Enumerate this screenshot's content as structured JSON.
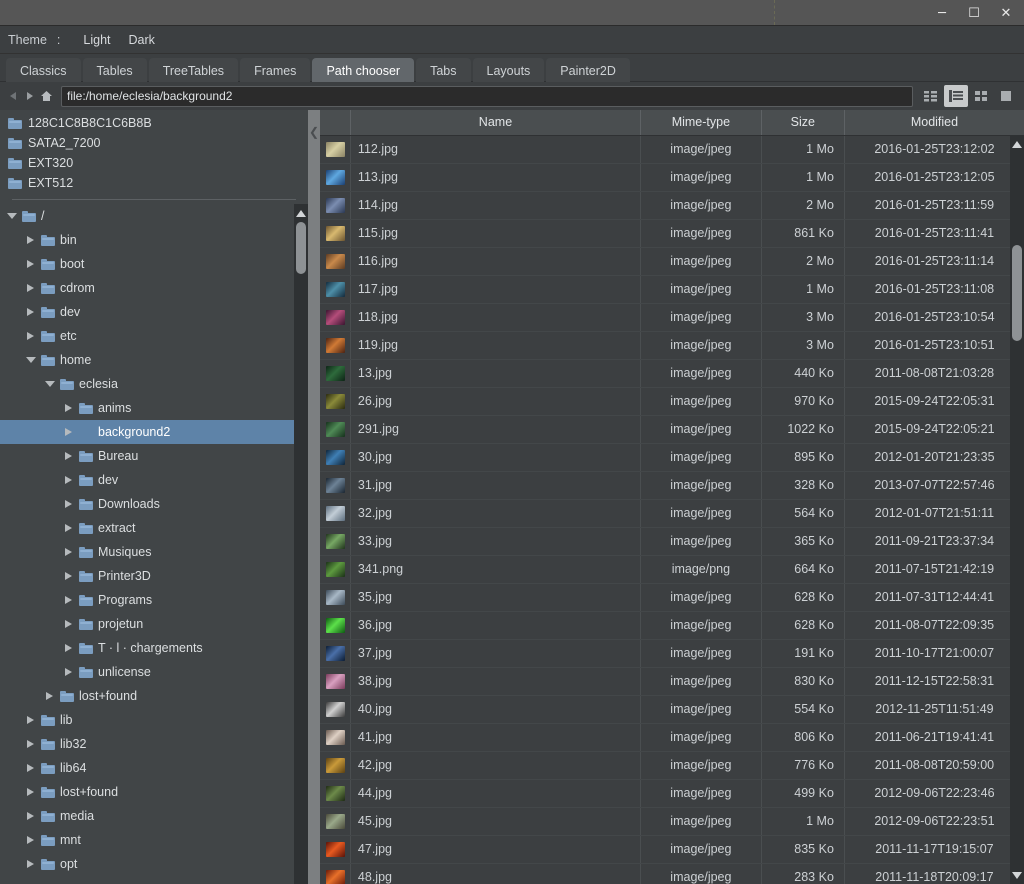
{
  "window": {
    "controls": [
      {
        "name": "minimize",
        "glyph": "—"
      },
      {
        "name": "maximize",
        "glyph": "▢"
      },
      {
        "name": "close",
        "glyph": "✕"
      }
    ]
  },
  "theme_bar": {
    "label": "Theme",
    "separator": ":",
    "options": [
      "Light",
      "Dark"
    ],
    "selected": "Dark"
  },
  "tabs": [
    {
      "label": "Classics",
      "active": false
    },
    {
      "label": "Tables",
      "active": false
    },
    {
      "label": "TreeTables",
      "active": false
    },
    {
      "label": "Frames",
      "active": false
    },
    {
      "label": "Path chooser",
      "active": true
    },
    {
      "label": "Tabs",
      "active": false
    },
    {
      "label": "Layouts",
      "active": false
    },
    {
      "label": "Painter2D",
      "active": false
    }
  ],
  "pathbar": {
    "back_title": "Back",
    "forward_title": "Forward",
    "home_title": "Home",
    "value": "file:/home/eclesia/background2",
    "placeholder": "file:/",
    "view_modes": [
      {
        "name": "compact-list-view",
        "active": false
      },
      {
        "name": "detail-list-view",
        "active": true
      },
      {
        "name": "grid-view",
        "active": false
      },
      {
        "name": "large-icon-view",
        "active": false
      }
    ]
  },
  "sidebar": {
    "places": [
      {
        "label": "128C1C8B8C1C6B8B"
      },
      {
        "label": "SATA2_7200"
      },
      {
        "label": "EXT320"
      },
      {
        "label": "EXT512"
      }
    ],
    "tree": [
      {
        "label": "/",
        "depth": 0,
        "expanded": true,
        "selected": false,
        "hasIcon": true
      },
      {
        "label": "bin",
        "depth": 1,
        "expanded": false,
        "selected": false,
        "hasIcon": true
      },
      {
        "label": "boot",
        "depth": 1,
        "expanded": false,
        "selected": false,
        "hasIcon": true
      },
      {
        "label": "cdrom",
        "depth": 1,
        "expanded": false,
        "selected": false,
        "hasIcon": true
      },
      {
        "label": "dev",
        "depth": 1,
        "expanded": false,
        "selected": false,
        "hasIcon": true
      },
      {
        "label": "etc",
        "depth": 1,
        "expanded": false,
        "selected": false,
        "hasIcon": true
      },
      {
        "label": "home",
        "depth": 1,
        "expanded": true,
        "selected": false,
        "hasIcon": true
      },
      {
        "label": "eclesia",
        "depth": 2,
        "expanded": true,
        "selected": false,
        "hasIcon": true
      },
      {
        "label": "anims",
        "depth": 3,
        "expanded": false,
        "selected": false,
        "hasIcon": true
      },
      {
        "label": "background2",
        "depth": 3,
        "expanded": false,
        "selected": true,
        "hasIcon": false
      },
      {
        "label": "Bureau",
        "depth": 3,
        "expanded": false,
        "selected": false,
        "hasIcon": true
      },
      {
        "label": "dev",
        "depth": 3,
        "expanded": false,
        "selected": false,
        "hasIcon": true
      },
      {
        "label": "Downloads",
        "depth": 3,
        "expanded": false,
        "selected": false,
        "hasIcon": true
      },
      {
        "label": "extract",
        "depth": 3,
        "expanded": false,
        "selected": false,
        "hasIcon": true
      },
      {
        "label": "Musiques",
        "depth": 3,
        "expanded": false,
        "selected": false,
        "hasIcon": true
      },
      {
        "label": "Printer3D",
        "depth": 3,
        "expanded": false,
        "selected": false,
        "hasIcon": true
      },
      {
        "label": "Programs",
        "depth": 3,
        "expanded": false,
        "selected": false,
        "hasIcon": true
      },
      {
        "label": "projetun",
        "depth": 3,
        "expanded": false,
        "selected": false,
        "hasIcon": true
      },
      {
        "label": "T · l · chargements",
        "depth": 3,
        "expanded": false,
        "selected": false,
        "hasIcon": true
      },
      {
        "label": "unlicense",
        "depth": 3,
        "expanded": false,
        "selected": false,
        "hasIcon": true
      },
      {
        "label": "lost+found",
        "depth": 2,
        "expanded": false,
        "selected": false,
        "hasIcon": true
      },
      {
        "label": "lib",
        "depth": 1,
        "expanded": false,
        "selected": false,
        "hasIcon": true
      },
      {
        "label": "lib32",
        "depth": 1,
        "expanded": false,
        "selected": false,
        "hasIcon": true
      },
      {
        "label": "lib64",
        "depth": 1,
        "expanded": false,
        "selected": false,
        "hasIcon": true
      },
      {
        "label": "lost+found",
        "depth": 1,
        "expanded": false,
        "selected": false,
        "hasIcon": true
      },
      {
        "label": "media",
        "depth": 1,
        "expanded": false,
        "selected": false,
        "hasIcon": true
      },
      {
        "label": "mnt",
        "depth": 1,
        "expanded": false,
        "selected": false,
        "hasIcon": true
      },
      {
        "label": "opt",
        "depth": 1,
        "expanded": false,
        "selected": false,
        "hasIcon": true
      }
    ]
  },
  "filetable": {
    "columns": [
      "",
      "Name",
      "Mime-type",
      "Size",
      "Modified"
    ],
    "rows": [
      {
        "name": "112.jpg",
        "mime": "image/jpeg",
        "size": "1 Mo",
        "modified": "2016-01-25T23:12:02",
        "color1": "#8a8263",
        "color2": "#d6cfa4"
      },
      {
        "name": "113.jpg",
        "mime": "image/jpeg",
        "size": "1 Mo",
        "modified": "2016-01-25T23:12:05",
        "color1": "#1b3f72",
        "color2": "#5fa8e0"
      },
      {
        "name": "114.jpg",
        "mime": "image/jpeg",
        "size": "2 Mo",
        "modified": "2016-01-25T23:11:59",
        "color1": "#2a3752",
        "color2": "#7b8db0"
      },
      {
        "name": "115.jpg",
        "mime": "image/jpeg",
        "size": "861 Ko",
        "modified": "2016-01-25T23:11:41",
        "color1": "#6b5430",
        "color2": "#d8b96f"
      },
      {
        "name": "116.jpg",
        "mime": "image/jpeg",
        "size": "2 Mo",
        "modified": "2016-01-25T23:11:14",
        "color1": "#5b3a22",
        "color2": "#c98a4b"
      },
      {
        "name": "117.jpg",
        "mime": "image/jpeg",
        "size": "1 Mo",
        "modified": "2016-01-25T23:11:08",
        "color1": "#132a3c",
        "color2": "#4e8fa8"
      },
      {
        "name": "118.jpg",
        "mime": "image/jpeg",
        "size": "3 Mo",
        "modified": "2016-01-25T23:10:54",
        "color1": "#3a1530",
        "color2": "#b44d7a"
      },
      {
        "name": "119.jpg",
        "mime": "image/jpeg",
        "size": "3 Mo",
        "modified": "2016-01-25T23:10:51",
        "color1": "#4a2212",
        "color2": "#d07a35"
      },
      {
        "name": "13.jpg",
        "mime": "image/jpeg",
        "size": "440 Ko",
        "modified": "2011-08-08T21:03:28",
        "color1": "#0d2416",
        "color2": "#2e6b3c"
      },
      {
        "name": "26.jpg",
        "mime": "image/jpeg",
        "size": "970 Ko",
        "modified": "2015-09-24T22:05:31",
        "color1": "#2a2a10",
        "color2": "#8a8a3a"
      },
      {
        "name": "291.jpg",
        "mime": "image/jpeg",
        "size": "1022 Ko",
        "modified": "2015-09-24T22:05:21",
        "color1": "#16301c",
        "color2": "#4f8a56"
      },
      {
        "name": "30.jpg",
        "mime": "image/jpeg",
        "size": "895 Ko",
        "modified": "2012-01-20T21:23:35",
        "color1": "#0f2438",
        "color2": "#3f7fb5"
      },
      {
        "name": "31.jpg",
        "mime": "image/jpeg",
        "size": "328 Ko",
        "modified": "2013-07-07T22:57:46",
        "color1": "#1a2530",
        "color2": "#6d8296"
      },
      {
        "name": "32.jpg",
        "mime": "image/jpeg",
        "size": "564 Ko",
        "modified": "2012-01-07T21:51:11",
        "color1": "#5d6e7e",
        "color2": "#c2cdd6"
      },
      {
        "name": "33.jpg",
        "mime": "image/jpeg",
        "size": "365 Ko",
        "modified": "2011-09-21T23:37:34",
        "color1": "#20331c",
        "color2": "#77a864"
      },
      {
        "name": "341.png",
        "mime": "image/png",
        "size": "664 Ko",
        "modified": "2011-07-15T21:42:19",
        "color1": "#1b3018",
        "color2": "#5d9a3f"
      },
      {
        "name": "35.jpg",
        "mime": "image/jpeg",
        "size": "628 Ko",
        "modified": "2011-07-31T12:44:41",
        "color1": "#3c4a58",
        "color2": "#a8b8c6"
      },
      {
        "name": "36.jpg",
        "mime": "image/jpeg",
        "size": "628 Ko",
        "modified": "2011-08-07T22:09:35",
        "color1": "#0e5a12",
        "color2": "#5ce04a"
      },
      {
        "name": "37.jpg",
        "mime": "image/jpeg",
        "size": "191 Ko",
        "modified": "2011-10-17T21:00:07",
        "color1": "#0b1c33",
        "color2": "#4a6fa8"
      },
      {
        "name": "38.jpg",
        "mime": "image/jpeg",
        "size": "830 Ko",
        "modified": "2011-12-15T22:58:31",
        "color1": "#7a3a5a",
        "color2": "#d8a0c0"
      },
      {
        "name": "40.jpg",
        "mime": "image/jpeg",
        "size": "554 Ko",
        "modified": "2012-11-25T11:51:49",
        "color1": "#3a3a3a",
        "color2": "#d0d0d0"
      },
      {
        "name": "41.jpg",
        "mime": "image/jpeg",
        "size": "806 Ko",
        "modified": "2011-06-21T19:41:41",
        "color1": "#6a5a50",
        "color2": "#ded0c4"
      },
      {
        "name": "42.jpg",
        "mime": "image/jpeg",
        "size": "776 Ko",
        "modified": "2011-08-08T20:59:00",
        "color1": "#5a4012",
        "color2": "#c99a3a"
      },
      {
        "name": "44.jpg",
        "mime": "image/jpeg",
        "size": "499 Ko",
        "modified": "2012-09-06T22:23:46",
        "color1": "#1e2a14",
        "color2": "#6d8a4a"
      },
      {
        "name": "45.jpg",
        "mime": "image/jpeg",
        "size": "1 Mo",
        "modified": "2012-09-06T22:23:51",
        "color1": "#4a4a3a",
        "color2": "#9aa88a"
      },
      {
        "name": "47.jpg",
        "mime": "image/jpeg",
        "size": "835 Ko",
        "modified": "2011-11-17T19:15:07",
        "color1": "#5a1208",
        "color2": "#e85a20"
      },
      {
        "name": "48.jpg",
        "mime": "image/jpeg",
        "size": "283 Ko",
        "modified": "2011-11-18T20:09:17",
        "color1": "#6a1a08",
        "color2": "#e8702a"
      }
    ]
  }
}
